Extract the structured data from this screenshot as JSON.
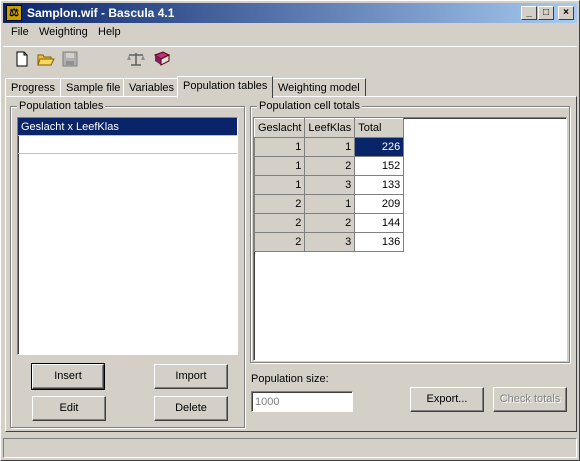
{
  "window": {
    "title": "Samplon.wif - Bascula 4.1",
    "app_icon": "scales-icon",
    "controls": {
      "minimize": "_",
      "maximize": "□",
      "close": "×"
    }
  },
  "menu": [
    {
      "label": "File"
    },
    {
      "label": "Weighting"
    },
    {
      "label": "Help"
    }
  ],
  "toolbar": [
    "new-file-icon",
    "open-folder-icon",
    "save-disk-icon",
    "scales-icon",
    "book-icon"
  ],
  "tabs": [
    {
      "label": "Progress"
    },
    {
      "label": "Sample file"
    },
    {
      "label": "Variables"
    },
    {
      "label": "Population tables",
      "active": true
    },
    {
      "label": "Weighting model"
    }
  ],
  "population_tables": {
    "label": "Population tables",
    "items": [
      "Geslacht x LeefKlas"
    ],
    "selected_index": 0,
    "buttons": {
      "insert": "Insert",
      "import": "Import",
      "edit": "Edit",
      "delete": "Delete"
    }
  },
  "cell_totals": {
    "label": "Population cell totals",
    "headers": [
      "Geslacht",
      "LeefKlas",
      "Total"
    ],
    "rows": [
      [
        "1",
        "1",
        "226"
      ],
      [
        "1",
        "2",
        "152"
      ],
      [
        "1",
        "3",
        "133"
      ],
      [
        "2",
        "1",
        "209"
      ],
      [
        "2",
        "2",
        "144"
      ],
      [
        "2",
        "3",
        "136"
      ]
    ],
    "selected_row": 0
  },
  "population_size": {
    "label": "Population size:",
    "value": "1000"
  },
  "actions": {
    "export": "Export...",
    "check_totals": "Check totals"
  },
  "colors": {
    "selection": "#0a246a",
    "face": "#d4d0c8"
  }
}
